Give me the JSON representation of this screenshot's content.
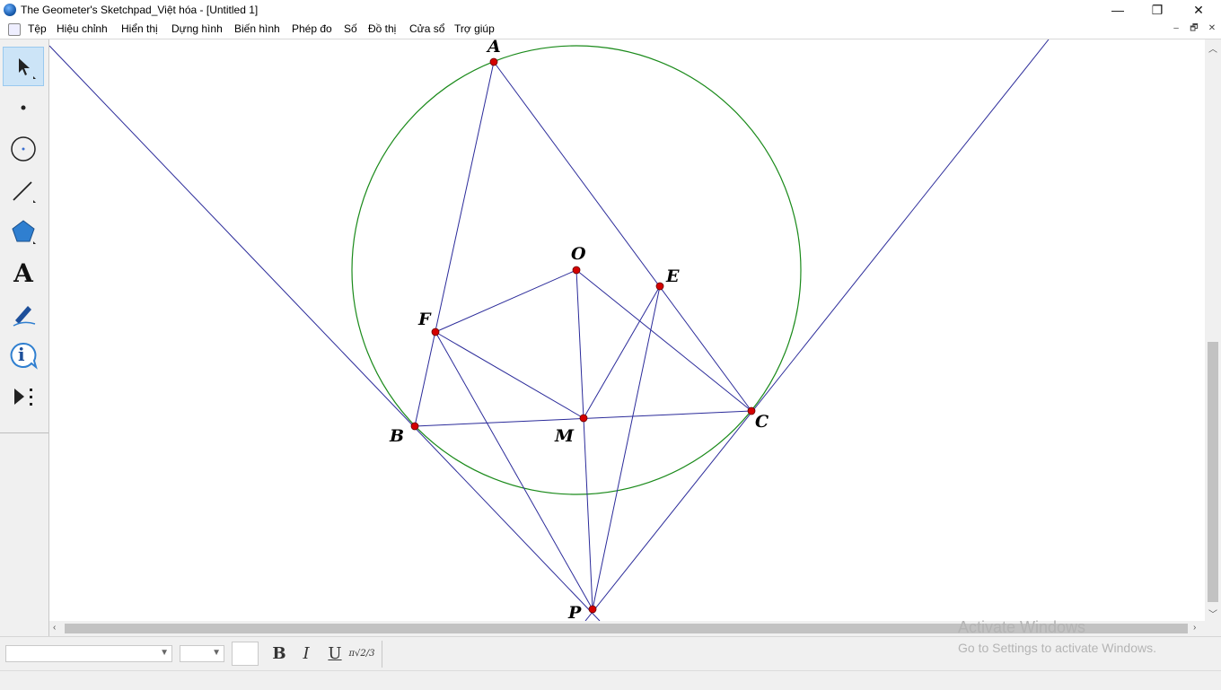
{
  "window": {
    "title": "The Geometer's Sketchpad_Việt hóa - [Untitled 1]",
    "minimize_glyph": "—",
    "restore_glyph": "❐",
    "close_glyph": "✕"
  },
  "menu": {
    "items": [
      "Tệp",
      "Hiệu chỉnh",
      "Hiển thị",
      "Dựng hình",
      "Biến hình",
      "Phép đo",
      "Số",
      "Đồ thị",
      "Cửa sổ",
      "Trợ giúp"
    ],
    "mdi_minimize": "–",
    "mdi_restore": "🗗",
    "mdi_close": "✕"
  },
  "toolbox": {
    "tools": [
      "arrow-select-icon",
      "point-icon",
      "compass-icon",
      "straightedge-icon",
      "polygon-icon",
      "text-icon",
      "marker-icon",
      "information-icon",
      "custom-tool-icon"
    ],
    "text_tool_glyph": "A",
    "info_glyph": "i"
  },
  "sketch": {
    "points": [
      {
        "label": "A"
      },
      {
        "label": "B"
      },
      {
        "label": "C"
      },
      {
        "label": "E"
      },
      {
        "label": "F"
      },
      {
        "label": "M"
      },
      {
        "label": "O"
      },
      {
        "label": "P"
      }
    ],
    "circle_color": "#1a8a1a",
    "line_color": "#2b2b9a",
    "point_color": "#d40000"
  },
  "textbar": {
    "bold": "B",
    "italic": "I",
    "underline": "U",
    "math_glyph": "π√2/3"
  },
  "watermark": {
    "line1": "Activate Windows",
    "line2": "Go to Settings to activate Windows."
  }
}
